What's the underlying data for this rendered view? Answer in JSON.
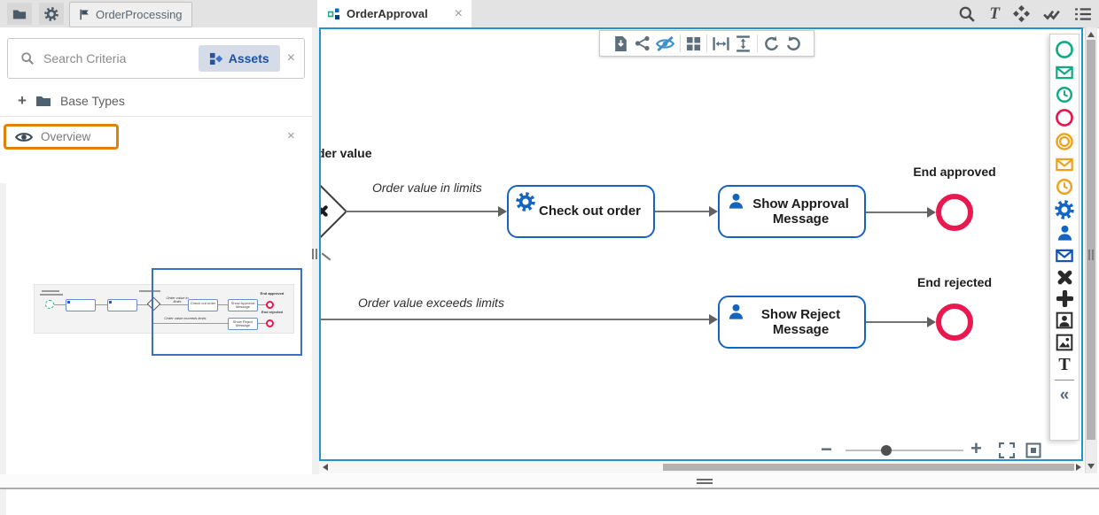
{
  "window": {
    "project_label": "OrderProcessing"
  },
  "tabbar": {
    "active_tab": "OrderApproval"
  },
  "sidebar": {
    "search_placeholder": "Search Criteria",
    "assets_button": "Assets",
    "base_types": "Base Types",
    "overview_title": "Overview"
  },
  "diagram": {
    "clipped_gateway_label": "der value",
    "flow_in_limits": "Order value in limits",
    "flow_exceeds": "Order value exceeds limits",
    "task_checkout": "Check out order",
    "task_show_approval": "Show Approval Message",
    "task_show_reject": "Show Reject Message",
    "end_approved": "End approved",
    "end_rejected": "End rejected"
  },
  "glyphs": {
    "close": "×",
    "add": "+",
    "zoom_out": "−",
    "zoom_in": "+",
    "text_tool": "T",
    "annotation_tool": "T",
    "collapse_palette": "«"
  },
  "colors": {
    "canvas_border": "#1e96d4",
    "task_border": "#1565c0",
    "end_event": "#e91850",
    "start_event_teal": "#12a985",
    "intermediate_orange": "#efa11c",
    "highlight_orange": "#e0820a",
    "assets_button_bg": "#d5dce8"
  }
}
